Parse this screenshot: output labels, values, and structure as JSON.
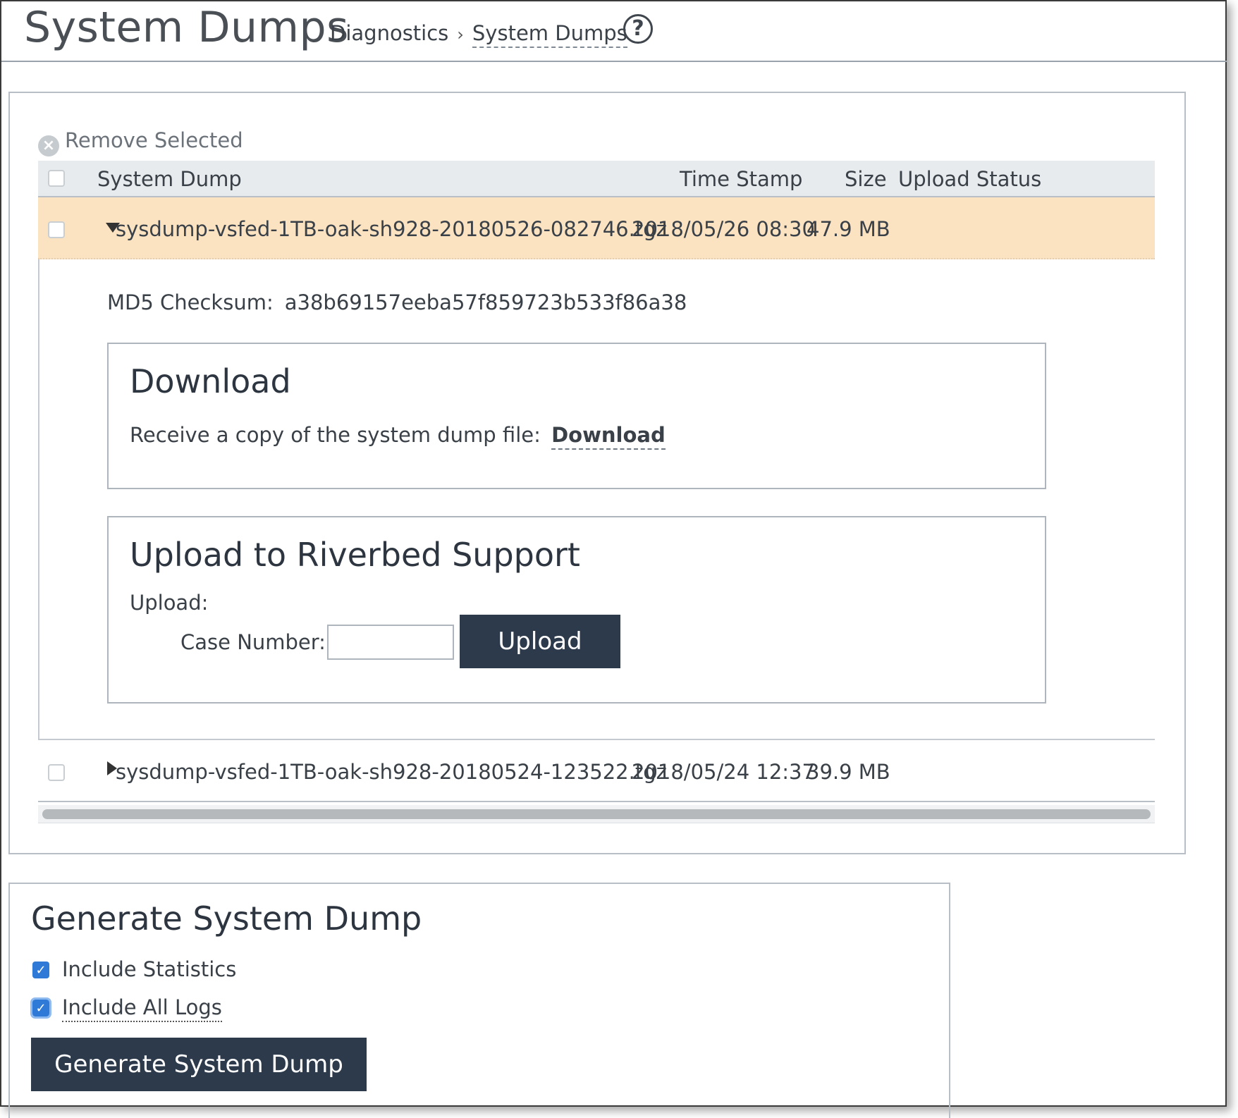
{
  "header": {
    "title": "System Dumps",
    "breadcrumb": [
      "Diagnostics",
      "System Dumps"
    ],
    "breadcrumb_sep": "›",
    "help_icon": "?"
  },
  "toolbar": {
    "remove_selected": "Remove Selected"
  },
  "table": {
    "columns": [
      "System Dump",
      "Time Stamp",
      "Size",
      "Upload Status"
    ],
    "rows": [
      {
        "name": "sysdump-vsfed-1TB-oak-sh928-20180526-082746.tgz",
        "timestamp": "2018/05/26 08:30",
        "size": "47.9 MB",
        "upload_status": "",
        "expanded": true,
        "selected": false
      },
      {
        "name": "sysdump-vsfed-1TB-oak-sh928-20180524-123522.tgz",
        "timestamp": "2018/05/24 12:37",
        "size": "39.9 MB",
        "upload_status": "",
        "expanded": false,
        "selected": false
      }
    ]
  },
  "detail": {
    "md5_label": "MD5 Checksum:",
    "md5_value": "a38b69157eeba57f859723b533f86a38",
    "download": {
      "title": "Download",
      "text": "Receive a copy of the system dump file:",
      "link": "Download"
    },
    "upload": {
      "title": "Upload to Riverbed Support",
      "label": "Upload:",
      "case_label": "Case Number:",
      "case_value": "",
      "button": "Upload"
    }
  },
  "generate": {
    "title": "Generate System Dump",
    "include_statistics": "Include Statistics",
    "include_statistics_checked": true,
    "include_all_logs": "Include All Logs",
    "include_all_logs_checked": true,
    "button": "Generate System Dump"
  },
  "colors": {
    "accent": "#2c3a4b",
    "selected_row": "#fbe3c2",
    "checkbox": "#2f7ad6"
  }
}
